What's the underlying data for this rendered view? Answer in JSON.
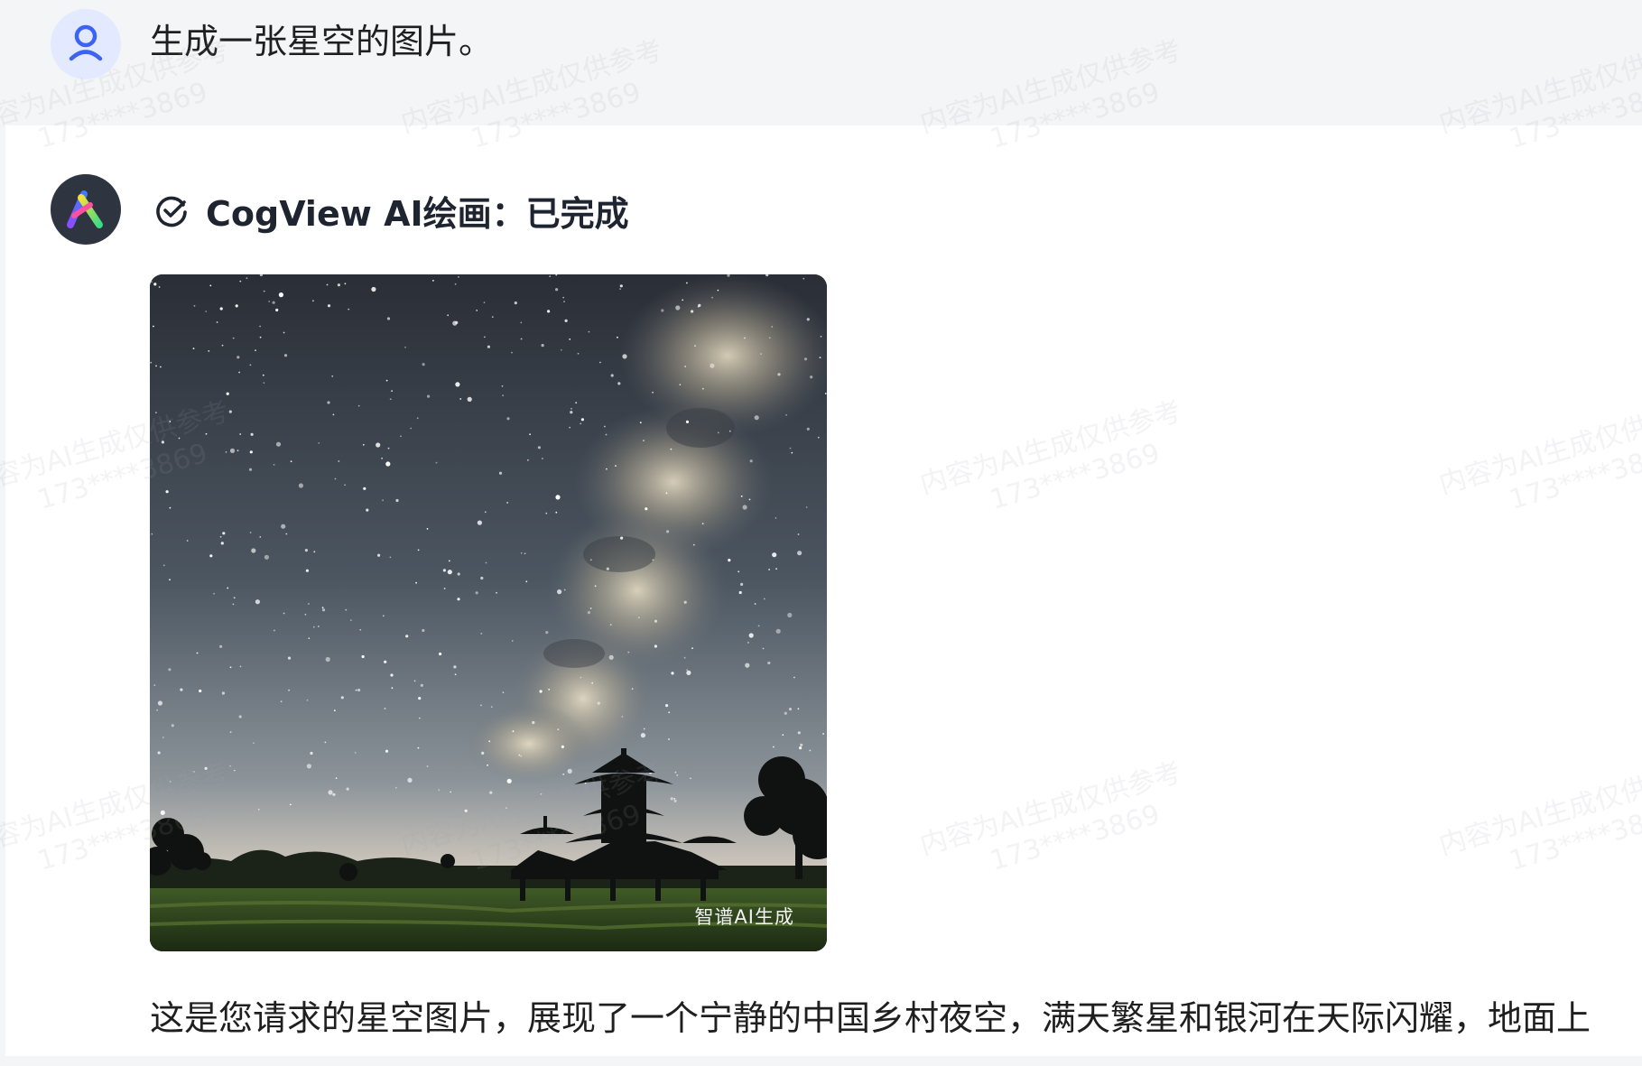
{
  "user": {
    "avatar_icon": "user-person-icon",
    "message": "生成一张星空的图片。"
  },
  "assistant": {
    "avatar_icon": "zhipu-logo-icon",
    "status_icon": "check-circle-icon",
    "status_text": "CogView AI绘画：已完成",
    "image_label": "智谱AI生成",
    "reply_text": "这是您请求的星空图片，展现了一个宁静的中国乡村夜空，满天繁星和银河在天际闪耀，地面上"
  },
  "watermark": {
    "line1": "内容为AI生成仅供参考",
    "line2": "173****3869"
  },
  "colors": {
    "accent_blue": "#3d63f5",
    "user_row_bg": "#f4f5f7",
    "bot_avatar_bg": "#2e3440"
  }
}
